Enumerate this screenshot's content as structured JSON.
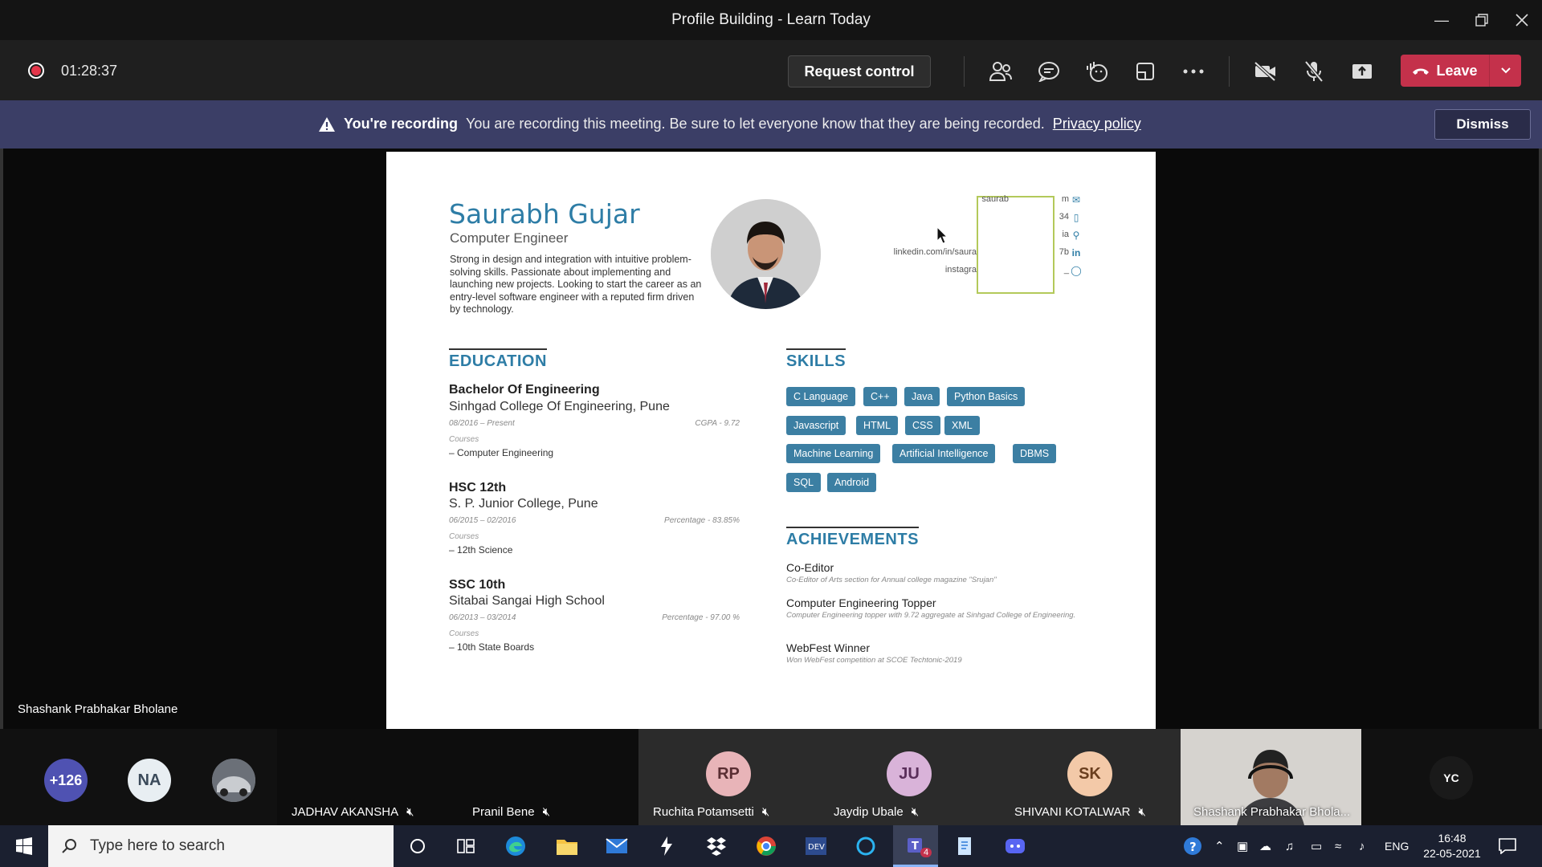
{
  "window": {
    "title": "Profile Building - Learn Today"
  },
  "toolbar": {
    "timer": "01:28:37",
    "request_control": "Request control",
    "leave": "Leave"
  },
  "banner": {
    "heading": "You're recording",
    "message": "You are recording this meeting. Be sure to let everyone know that they are being recorded.",
    "link": "Privacy policy",
    "dismiss": "Dismiss"
  },
  "presenter": {
    "name": "Shashank Prabhakar Bholane"
  },
  "resume": {
    "name": "Saurabh Gujar",
    "role": "Computer Engineer",
    "summary": "Strong in design and integration with intuitive problem-solving skills. Passionate about implementing and launching new projects. Looking to start the career as an entry-level software engineer with a reputed firm driven by technology.",
    "contacts": [
      "saurab",
      "m",
      "34",
      "ia",
      "linkedin.com/in/saura",
      "7b",
      "instagra",
      "_"
    ],
    "education_title": "EDUCATION",
    "education": [
      {
        "degree": "Bachelor Of Engineering",
        "school": "Sinhgad College Of Engineering, Pune",
        "dates": "08/2016 – Present",
        "score": "CGPA - 9.72",
        "courses_label": "Courses",
        "course": "Computer Engineering"
      },
      {
        "degree": "HSC 12th",
        "school": "S. P. Junior College, Pune",
        "dates": "06/2015 – 02/2016",
        "score": "Percentage - 83.85%",
        "courses_label": "Courses",
        "course": "12th Science"
      },
      {
        "degree": "SSC 10th",
        "school": "Sitabai Sangai High School",
        "dates": "06/2013 – 03/2014",
        "score": "Percentage - 97.00 %",
        "courses_label": "Courses",
        "course": "10th State Boards"
      }
    ],
    "skills_title": "SKILLS",
    "skills": [
      "C Language",
      "C++",
      "Java",
      "Python Basics",
      "Javascript",
      "HTML",
      "CSS",
      "XML",
      "Machine Learning",
      "Artificial Intelligence",
      "DBMS",
      "SQL",
      "Android"
    ],
    "achievements_title": "ACHIEVEMENTS",
    "achievements": [
      {
        "title": "Co-Editor",
        "desc": "Co-Editor of Arts section for Annual college magazine \"Srujan\""
      },
      {
        "title": "Computer Engineering Topper",
        "desc": "Computer Engineering topper with 9.72 aggregate at Sinhgad College of Engineering."
      },
      {
        "title": "WebFest Winner",
        "desc": "Won WebFest competition at SCOE Techtonic-2019"
      }
    ]
  },
  "participants": {
    "overflow": "+126",
    "na": "NA",
    "tiles": [
      {
        "name": "JADHAV AKANSHA"
      },
      {
        "name": "Pranil Bene"
      },
      {
        "initials": "RP",
        "name": "Ruchita Potamsetti",
        "color": "#e8b4b8"
      },
      {
        "initials": "JU",
        "name": "Jaydip Ubale",
        "color": "#d9b3d9"
      },
      {
        "initials": "SK",
        "name": "SHIVANI KOTALWAR",
        "color": "#f3c9a8"
      },
      {
        "name": "Shashank Prabhakar Bhola..."
      }
    ],
    "self": "YC"
  },
  "taskbar": {
    "search_placeholder": "Type here to search",
    "lang": "ENG",
    "time": "16:48",
    "date": "22-05-2021",
    "teams_badge": "4"
  }
}
